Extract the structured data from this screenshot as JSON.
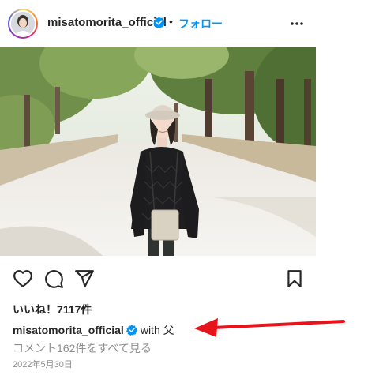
{
  "post": {
    "username": "misatomorita_official",
    "separator": "•",
    "follow_label": "フォロー",
    "likes_text": "いいね！7117件",
    "caption": {
      "username": "misatomorita_official",
      "text": "with 父"
    },
    "comments_link": "コメント162件をすべて見る",
    "date": "2022年5月30日"
  },
  "icons": {
    "verified": "verified-badge-icon",
    "more": "more-options-icon",
    "like": "heart-icon",
    "comment": "comment-icon",
    "share": "share-icon",
    "save": "bookmark-icon"
  },
  "colors": {
    "link_blue": "#0095f6",
    "verified_blue": "#0095f6",
    "annotation_arrow": "#e8141b",
    "muted_text": "#8e8e8e"
  }
}
